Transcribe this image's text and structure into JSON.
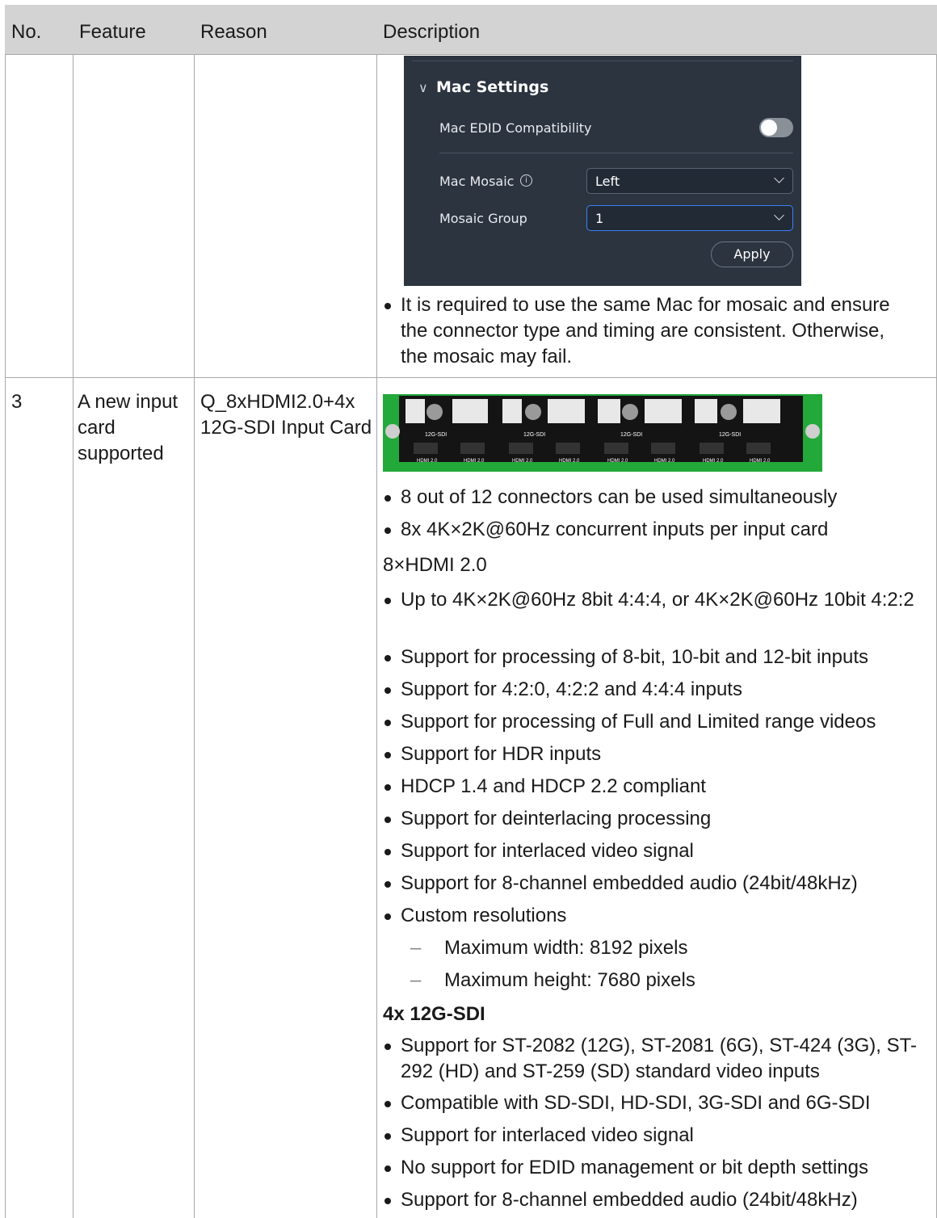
{
  "table": {
    "headers": [
      "No.",
      "Feature",
      "Reason",
      "Description"
    ]
  },
  "mac_panel": {
    "section_title": "Mac Settings",
    "edid_label": "Mac EDID Compatibility",
    "mosaic_label": "Mac Mosaic",
    "mosaic_value": "Left",
    "group_label": "Mosaic Group",
    "group_value": "1",
    "apply_label": "Apply",
    "toggle_on": false
  },
  "row_prev": {
    "bullet": "It is required to use the same Mac for mosaic and ensure the connector type and timing are consistent. Otherwise, the mosaic may fail."
  },
  "row3": {
    "no": "3",
    "feature": "A new input card supported",
    "reason": "Q_8xHDMI2.0+4x 12G-SDI Input Card",
    "card_labels": {
      "sdi": "12G-SDI",
      "hdmi": "HDMI 2.0"
    },
    "intro_bullets": [
      "8 out of 12 connectors can be used simultaneously",
      "8x 4K×2K@60Hz concurrent inputs per input card"
    ],
    "hdmi_heading": "8×HDMI 2.0",
    "hdmi_bullets": [
      "Up to 4K×2K@60Hz 8bit 4:4:4, or 4K×2K@60Hz 10bit 4:2:2",
      "Support for processing of 8-bit, 10-bit and 12-bit inputs",
      "Support for 4:2:0, 4:2:2 and 4:4:4 inputs",
      "Support for processing of Full and Limited range videos",
      "Support for HDR inputs",
      "HDCP 1.4 and HDCP 2.2 compliant",
      "Support for deinterlacing processing",
      "Support for interlaced video signal",
      "Support for 8-channel embedded audio (24bit/48kHz)",
      "Custom resolutions"
    ],
    "custom_sub": [
      "Maximum width: 8192 pixels",
      "Maximum height: 7680 pixels"
    ],
    "sdi_heading": "4x 12G-SDI",
    "sdi_bullets": [
      "Support for ST-2082 (12G), ST-2081 (6G), ST-424 (3G), ST-292 (HD) and ST-259 (SD) standard video inputs",
      "Compatible with SD-SDI, HD-SDI, 3G-SDI and 6G-SDI",
      "Support for interlaced video signal",
      "No support for EDID management or bit depth settings",
      "Support for 8-channel embedded audio (24bit/48kHz)"
    ]
  }
}
